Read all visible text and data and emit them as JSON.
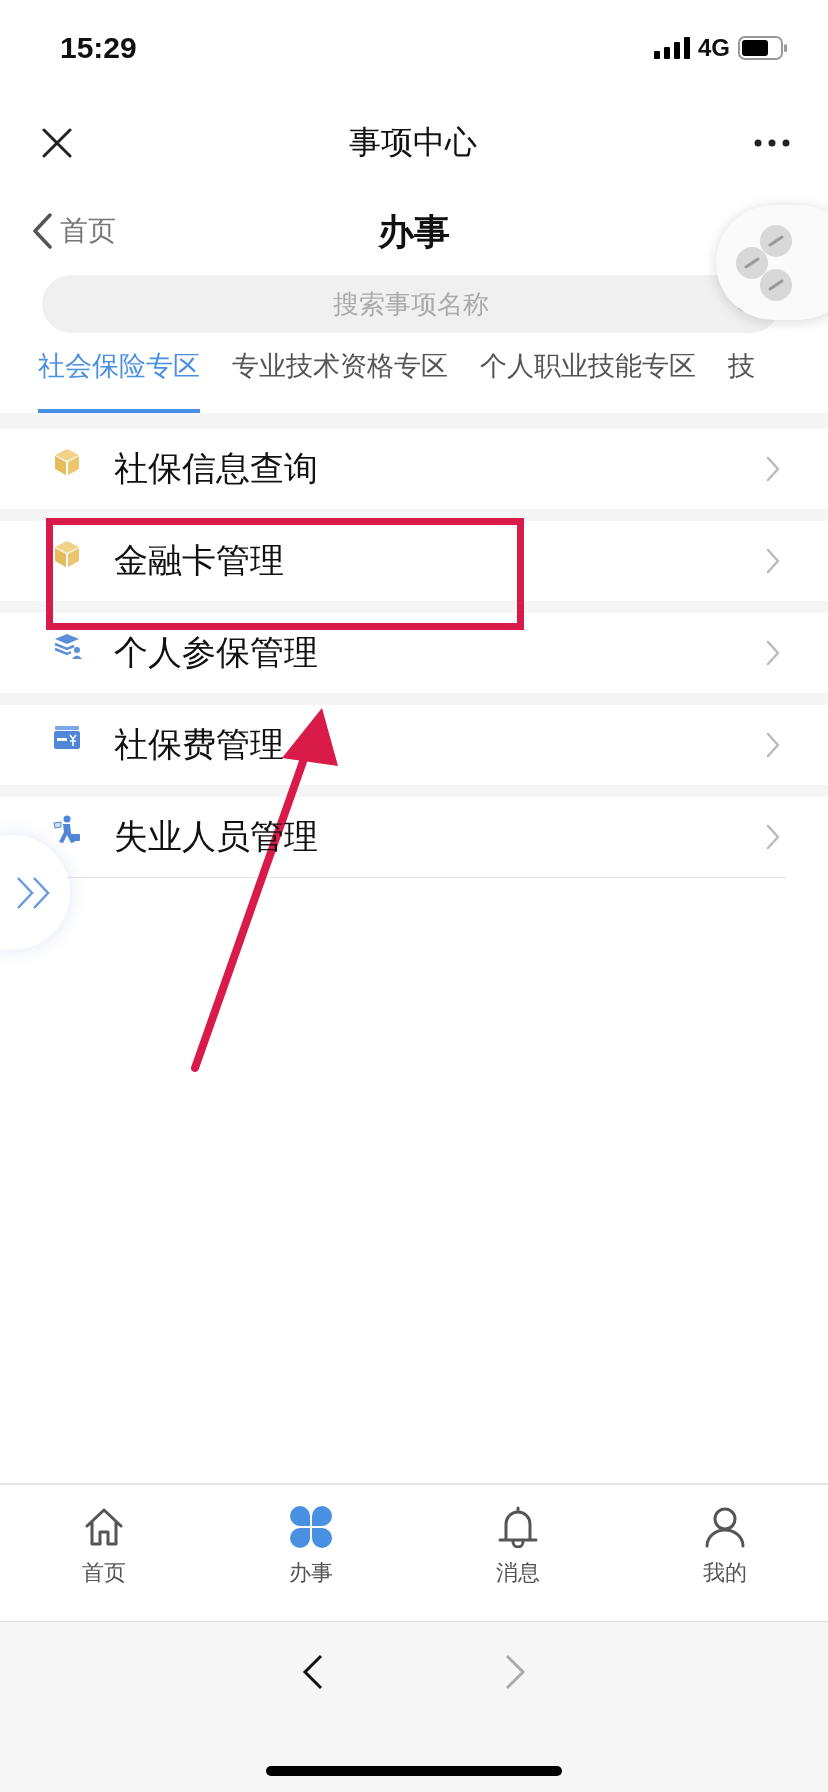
{
  "status_bar": {
    "time": "15:29",
    "network": "4G"
  },
  "nav": {
    "title": "事项中心"
  },
  "header": {
    "back": "首页",
    "title": "办事"
  },
  "search": {
    "placeholder": "搜索事项名称"
  },
  "tabs": [
    {
      "label": "社会保险专区",
      "selected": true
    },
    {
      "label": "专业技术资格专区",
      "selected": false
    },
    {
      "label": "个人职业技能专区",
      "selected": false
    },
    {
      "label": "技",
      "selected": false
    }
  ],
  "items": [
    {
      "label": "社保信息查询",
      "kind": "box"
    },
    {
      "label": "金融卡管理",
      "kind": "box"
    },
    {
      "label": "个人参保管理",
      "kind": "stack"
    },
    {
      "label": "社保费管理",
      "kind": "card"
    },
    {
      "label": "失业人员管理",
      "kind": "runner"
    }
  ],
  "bottom_tabs": [
    {
      "label": "首页",
      "kind": "home",
      "selected": false
    },
    {
      "label": "办事",
      "kind": "apps",
      "selected": true
    },
    {
      "label": "消息",
      "kind": "bell",
      "selected": false
    },
    {
      "label": "我的",
      "kind": "user",
      "selected": false
    }
  ]
}
